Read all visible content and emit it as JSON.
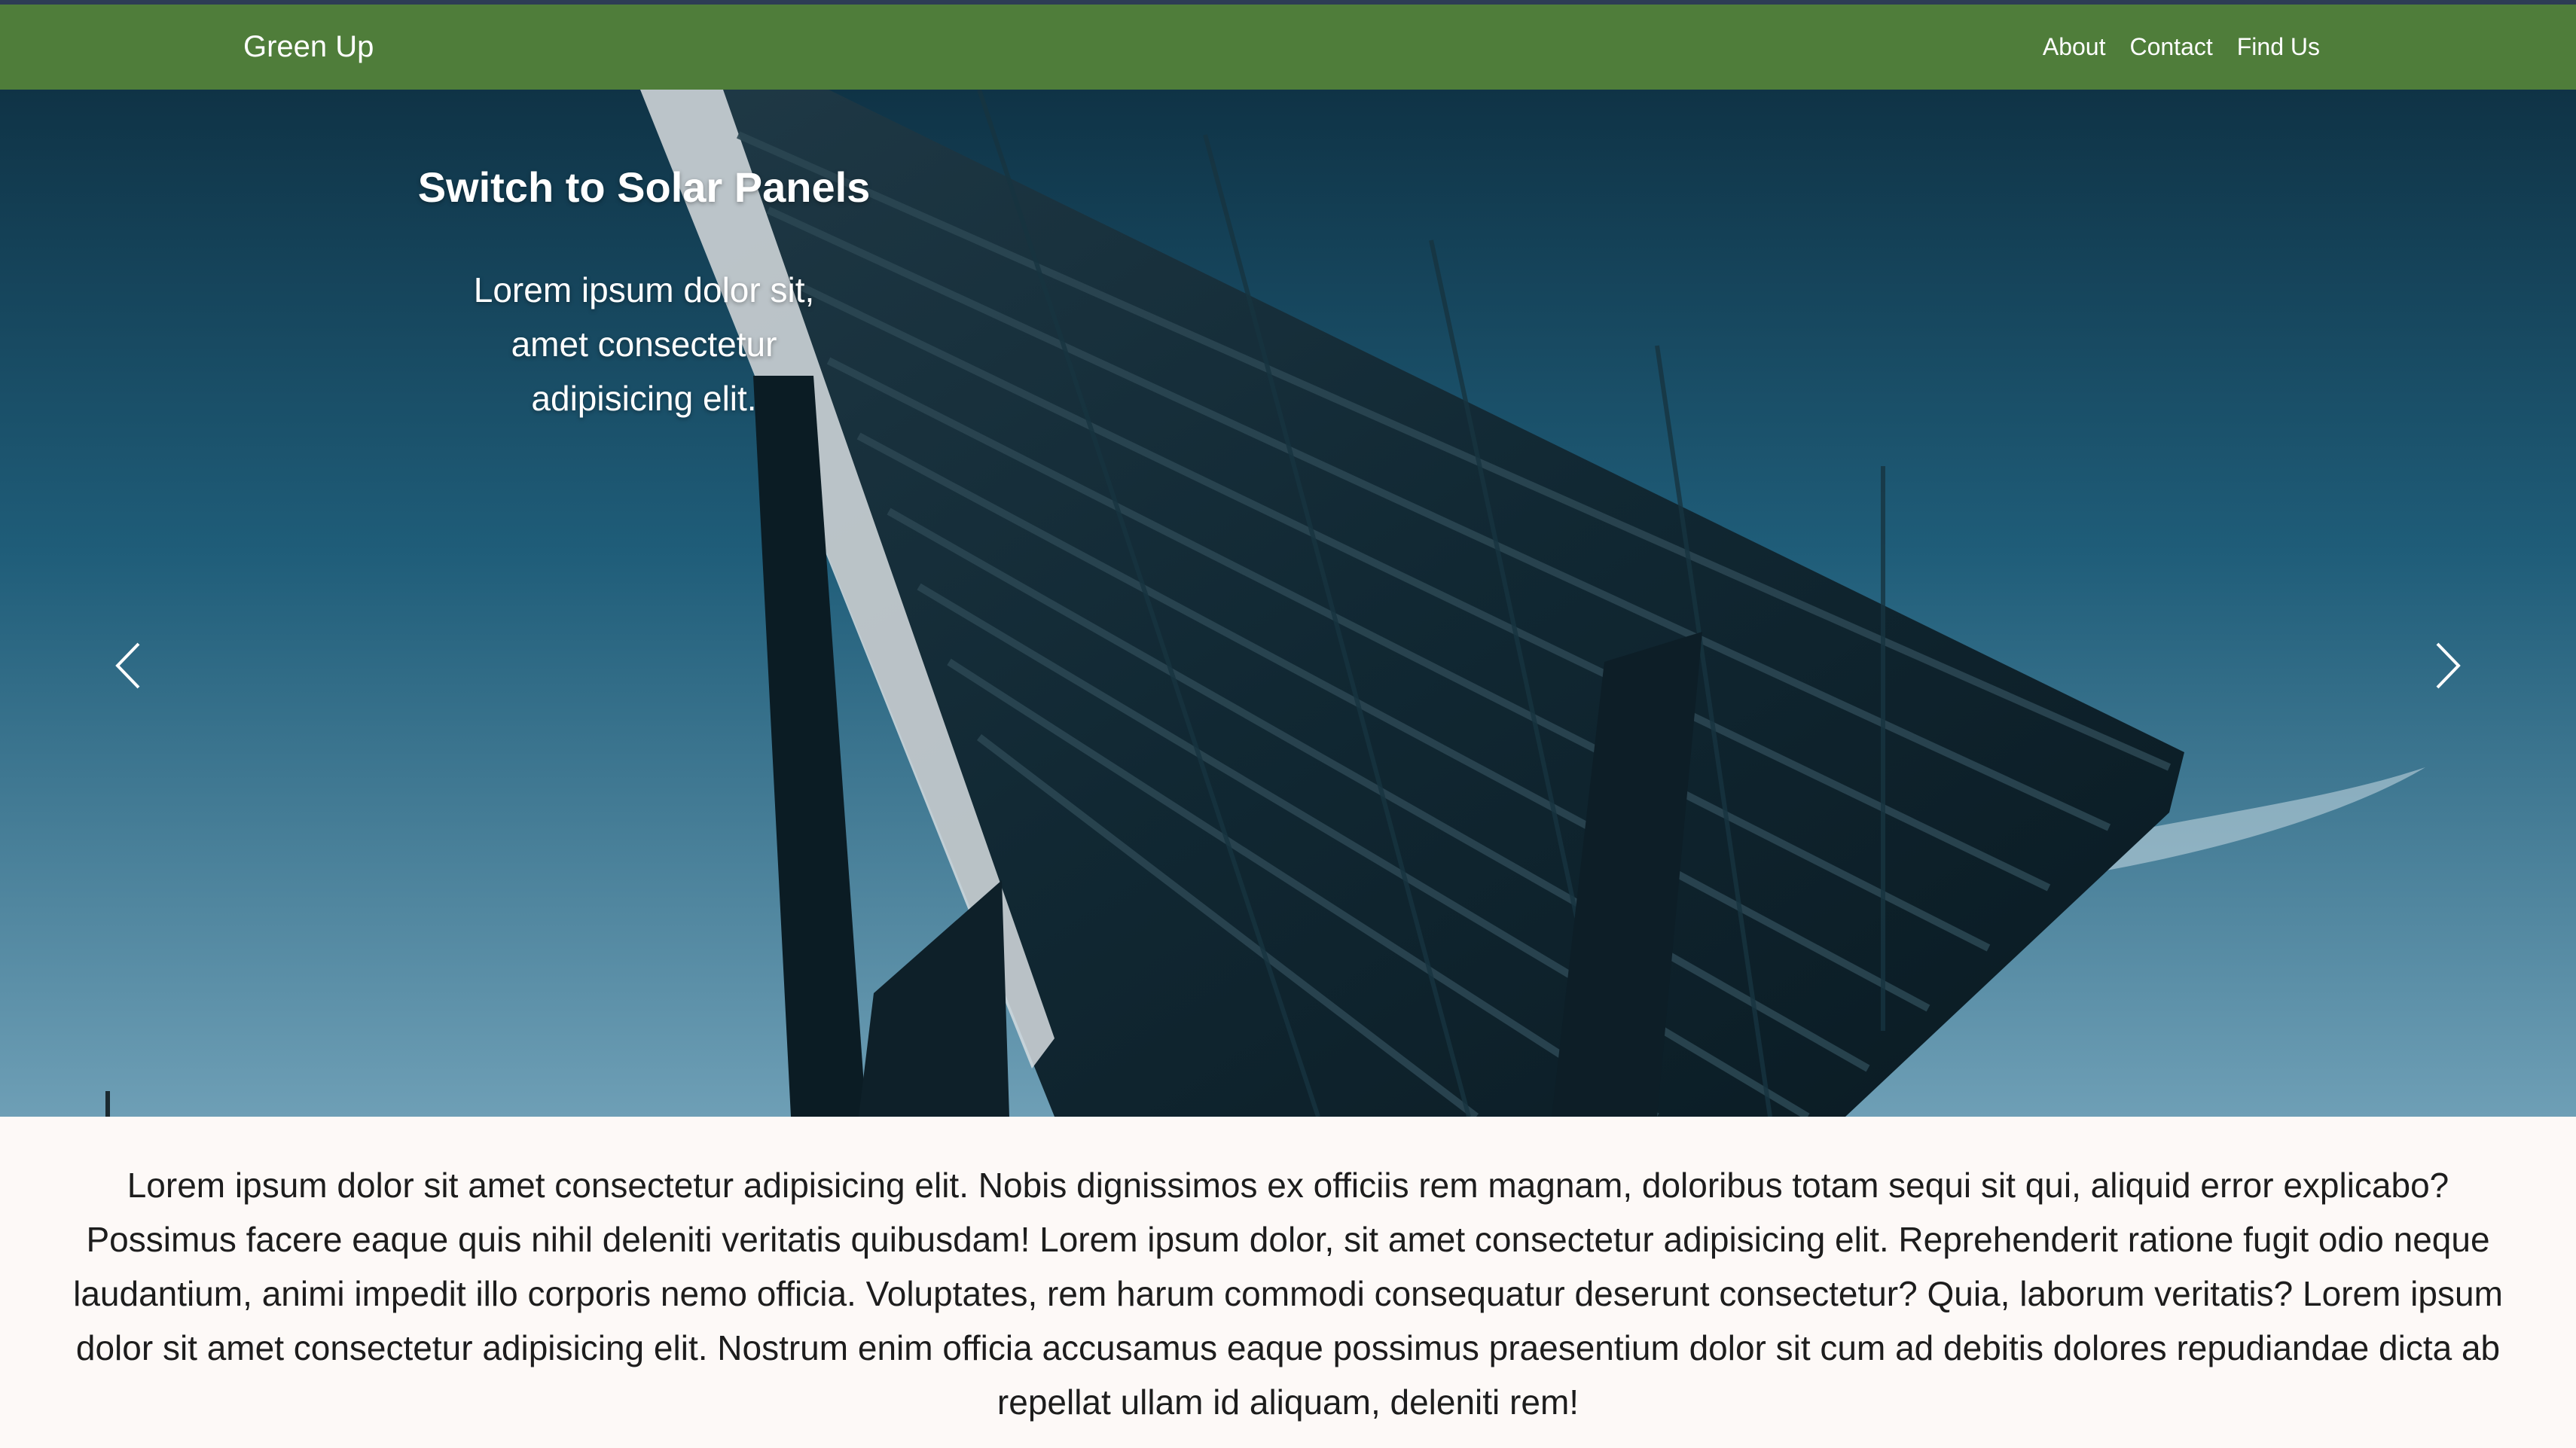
{
  "navbar": {
    "brand": "Green Up",
    "links": [
      "About",
      "Contact",
      "Find Us"
    ]
  },
  "carousel": {
    "slide": {
      "title": "Switch to Solar Panels",
      "text": "Lorem ipsum dolor sit, amet consectetur adipisicing elit."
    },
    "prev_icon": "chevron-left-icon",
    "next_icon": "chevron-right-icon"
  },
  "main": {
    "paragraph": "Lorem ipsum dolor sit amet consectetur adipisicing elit. Nobis dignissimos ex officiis rem magnam, doloribus totam sequi sit qui, aliquid error explicabo? Possimus facere eaque quis nihil deleniti veritatis quibusdam! Lorem ipsum dolor, sit amet consectetur adipisicing elit. Reprehenderit ratione fugit odio neque laudantium, animi impedit illo corporis nemo officia. Voluptates, rem harum commodi consequatur deserunt consectetur? Quia, laborum veritatis? Lorem ipsum dolor sit amet consectetur adipisicing elit. Nostrum enim officia accusamus eaque possimus praesentium dolor sit cum ad debitis dolores repudiandae dicta ab repellat ullam id aliquam, deleniti rem!"
  },
  "colors": {
    "navbar": "#4f7d3a",
    "top_strip": "#2d3c55",
    "page_background": "#fdf9f7"
  }
}
